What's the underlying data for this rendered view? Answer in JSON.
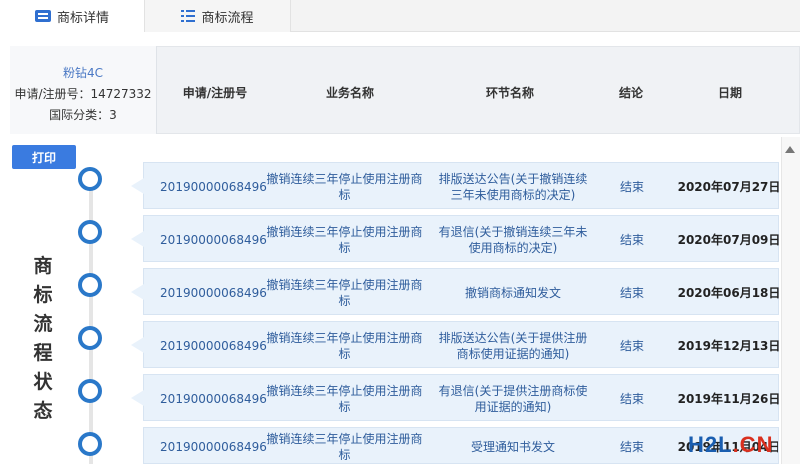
{
  "tabs": [
    {
      "label": "商标详情",
      "icon": "card-icon"
    },
    {
      "label": "商标流程",
      "icon": "list-icon"
    }
  ],
  "info": {
    "name": "粉钻4C",
    "reg_line": "申请/注册号：14727332",
    "class_line": "国际分类：3"
  },
  "columns": {
    "reg": "申请/注册号",
    "biz": "业务名称",
    "step": "环节名称",
    "result": "结论",
    "date": "日期"
  },
  "print_label": "打印",
  "vertical_title": [
    "商",
    "标",
    "流",
    "程",
    "状",
    "态"
  ],
  "rows": [
    {
      "reg": "20190000068496",
      "biz": "撤销连续三年停止使用注册商标",
      "step": "排版送达公告(关于撤销连续三年未使用商标的决定)",
      "result": "结束",
      "date": "2020年07月27日"
    },
    {
      "reg": "20190000068496",
      "biz": "撤销连续三年停止使用注册商标",
      "step": "有退信(关于撤销连续三年未使用商标的决定)",
      "result": "结束",
      "date": "2020年07月09日"
    },
    {
      "reg": "20190000068496",
      "biz": "撤销连续三年停止使用注册商标",
      "step": "撤销商标通知发文",
      "result": "结束",
      "date": "2020年06月18日"
    },
    {
      "reg": "20190000068496",
      "biz": "撤销连续三年停止使用注册商标",
      "step": "排版送达公告(关于提供注册商标使用证据的通知)",
      "result": "结束",
      "date": "2019年12月13日"
    },
    {
      "reg": "20190000068496",
      "biz": "撤销连续三年停止使用注册商标",
      "step": "有退信(关于提供注册商标使用证据的通知)",
      "result": "结束",
      "date": "2019年11月26日"
    },
    {
      "reg": "20190000068496",
      "biz": "撤销连续三年停止使用注册商标",
      "step": "受理通知书发文",
      "result": "结束",
      "date": "2019年11月04日"
    }
  ],
  "watermark": {
    "part1": "H2L",
    "part2": ".CN"
  }
}
